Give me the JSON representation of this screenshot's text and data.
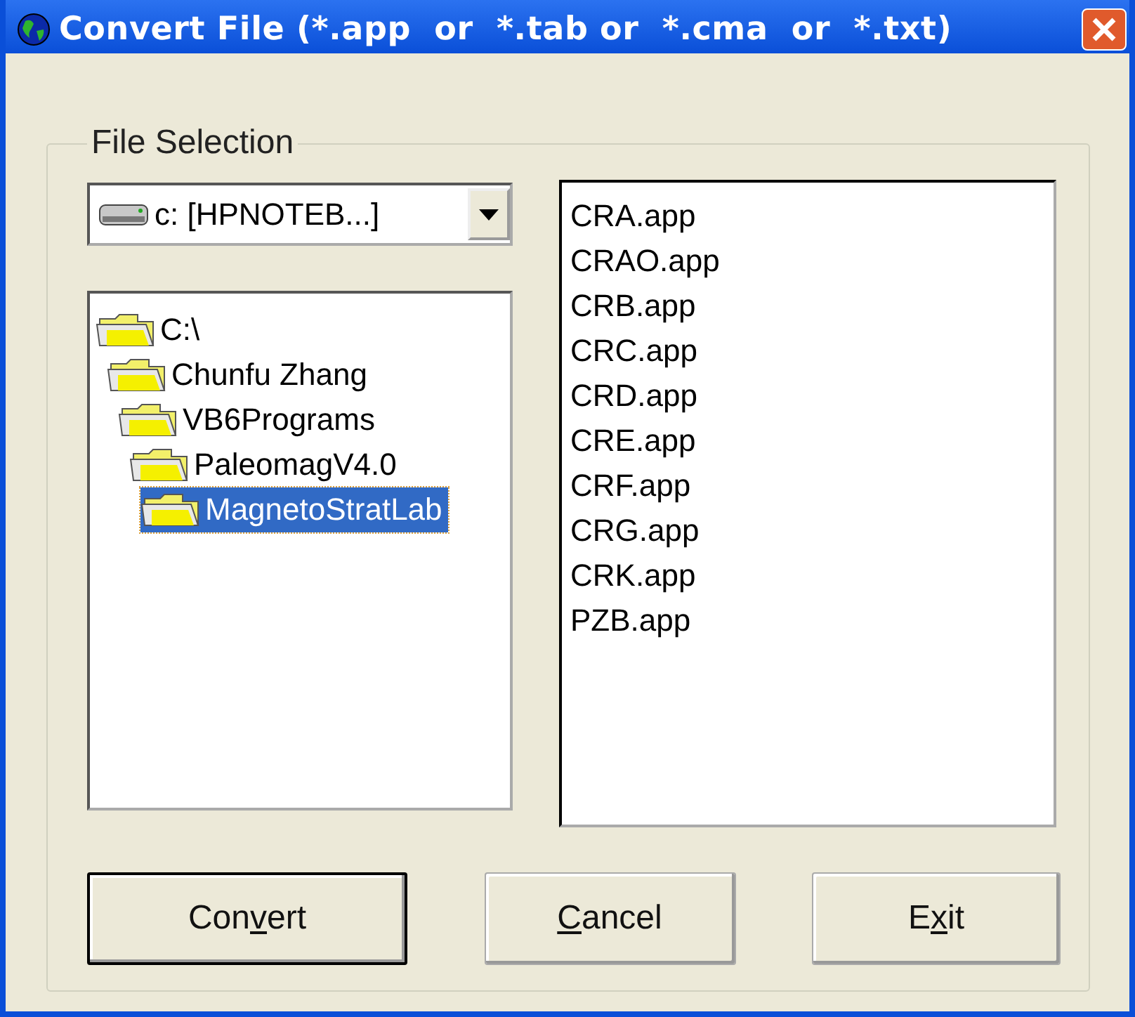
{
  "window": {
    "title": "Convert File (*.app  or  *.tab or  *.cma  or  *.txt)"
  },
  "file_selection": {
    "label": "File Selection",
    "drive": {
      "value": "c: [HPNOTEB...]"
    },
    "folders": [
      {
        "name": "C:\\",
        "selected": false,
        "children": [
          {
            "name": "Chunfu Zhang",
            "selected": false,
            "children": [
              {
                "name": "VB6Programs",
                "selected": false,
                "children": [
                  {
                    "name": "PaleomagV4.0",
                    "selected": false,
                    "children": [
                      {
                        "name": "MagnetoStratLab",
                        "selected": true
                      }
                    ]
                  }
                ]
              }
            ]
          }
        ]
      }
    ],
    "files": [
      "CRA.app",
      "CRAO.app",
      "CRB.app",
      "CRC.app",
      "CRD.app",
      "CRE.app",
      "CRF.app",
      "CRG.app",
      "CRK.app",
      "PZB.app"
    ]
  },
  "buttons": [
    {
      "before": "Con",
      "key": "v",
      "after": "ert",
      "default": true
    },
    {
      "key": "C",
      "after": "ancel",
      "default": false
    },
    {
      "before": "E",
      "key": "x",
      "after": "it",
      "default": false
    }
  ]
}
